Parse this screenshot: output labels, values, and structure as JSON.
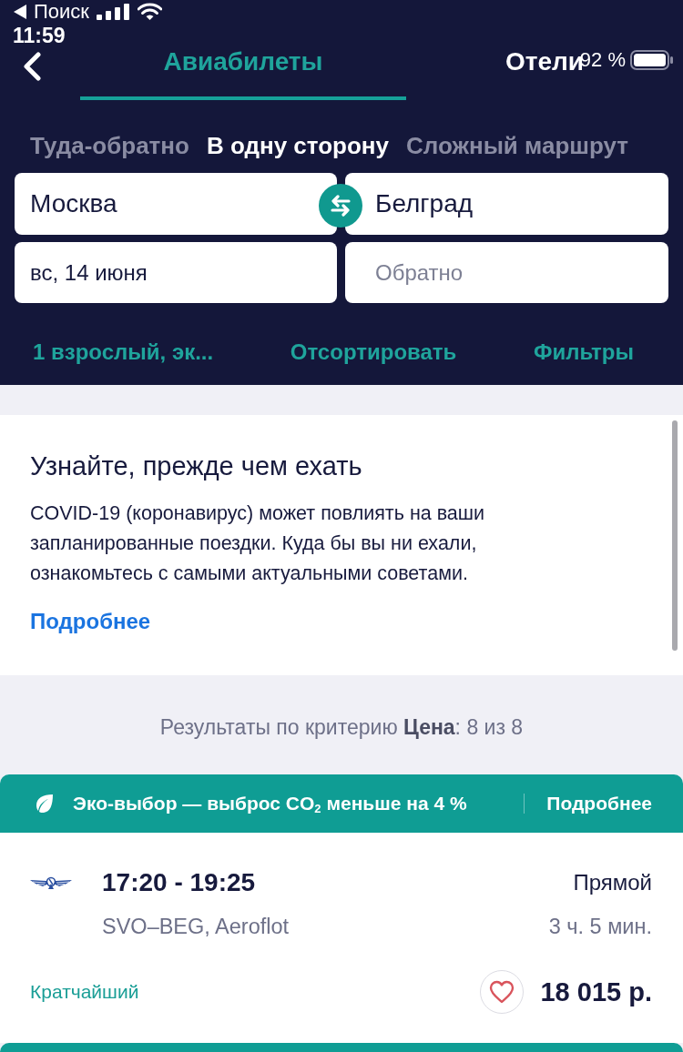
{
  "status_bar": {
    "back_label": "Поиск",
    "time": "11:59",
    "battery": "92 %"
  },
  "header": {
    "tabs": [
      {
        "label": "Авиабилеты",
        "selected": true
      },
      {
        "label": "Отели",
        "selected": false
      }
    ],
    "trip_types": [
      {
        "label": "Туда-обратно",
        "selected": false
      },
      {
        "label": "В одну сторону",
        "selected": true
      },
      {
        "label": "Сложный маршрут",
        "selected": false
      }
    ],
    "search": {
      "origin": {
        "value": "Москва"
      },
      "destination": {
        "value": "Белград"
      },
      "departure": {
        "value": "вс, 14 июня"
      },
      "return": {
        "placeholder": "Обратно"
      }
    },
    "options": [
      {
        "label": "1 взрослый, эк..."
      },
      {
        "label": "Отсортировать"
      },
      {
        "label": "Фильтры"
      }
    ]
  },
  "notice": {
    "title": "Узнайте, прежде чем ехать",
    "body": "COVID-19 (коронавирус) может повлиять на ваши запланированные поездки. Куда бы вы ни ехали, ознакомьтесь с самыми актуальными советами.",
    "link": "Подробнее"
  },
  "results_summary": "Результаты по критерию **Цена**: 8 из 8",
  "results": [
    {
      "eco_banner": {
        "text": "Эко-выбор — выброс CO$_{2}$ меньше на 4 %",
        "link": "Подробнее"
      },
      "times": "17:20 - 19:25",
      "route": "SVO–BEG, Aeroflot",
      "stops": "Прямой",
      "duration": "3 ч. 5 мин.",
      "tag": "Кратчайший",
      "favorite": false,
      "price": "18 015 р."
    }
  ]
}
